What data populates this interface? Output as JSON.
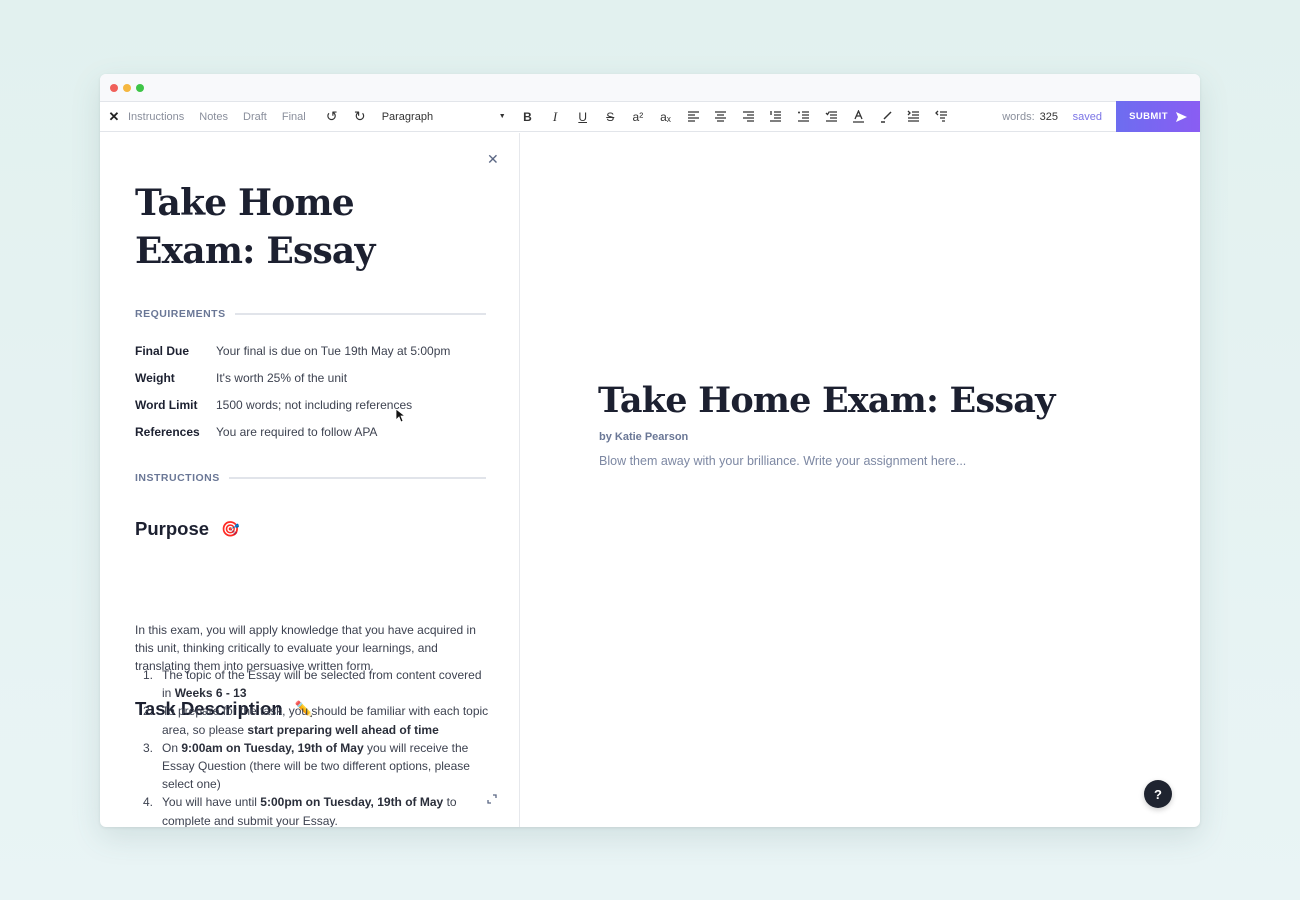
{
  "window": {
    "traffic_lights": {
      "close": "#f0605a",
      "minimize": "#f5b740",
      "maximize": "#3ec547"
    }
  },
  "toolbar": {
    "close_icon": "✕",
    "tabs": [
      {
        "label": "Instructions"
      },
      {
        "label": "Notes"
      },
      {
        "label": "Draft"
      },
      {
        "label": "Final"
      }
    ],
    "undo_icon": "↺",
    "redo_icon": "↻",
    "block_format": {
      "selected": "Paragraph",
      "caret": "▼"
    },
    "format_buttons": [
      {
        "name": "bold",
        "glyph": "B"
      },
      {
        "name": "italic",
        "glyph": "I"
      },
      {
        "name": "underline",
        "glyph": "U"
      },
      {
        "name": "strikethrough",
        "glyph": "S"
      },
      {
        "name": "superscript",
        "glyph": "a²"
      },
      {
        "name": "subscript",
        "glyph": "aₓ"
      },
      {
        "name": "align-left",
        "glyph": ""
      },
      {
        "name": "align-center",
        "glyph": ""
      },
      {
        "name": "align-right",
        "glyph": ""
      },
      {
        "name": "ordered-list",
        "glyph": ""
      },
      {
        "name": "bullet-list",
        "glyph": ""
      },
      {
        "name": "check-list",
        "glyph": ""
      },
      {
        "name": "text-color",
        "glyph": ""
      },
      {
        "name": "highlight",
        "glyph": ""
      },
      {
        "name": "indent",
        "glyph": ""
      },
      {
        "name": "outdent",
        "glyph": ""
      }
    ],
    "words_label": "words:",
    "word_count": "325",
    "save_status": "saved",
    "submit_label": "SUBMIT",
    "accent_color": "#7b74e6"
  },
  "instructions_panel": {
    "close_icon": "✕",
    "title": "Take Home Exam: Essay",
    "requirements_heading": "REQUIREMENTS",
    "requirements": [
      {
        "key": "Final Due",
        "value": "Your final is due on Tue 19th May at 5:00pm"
      },
      {
        "key": "Weight",
        "value": "It's worth 25% of the unit"
      },
      {
        "key": "Word Limit",
        "value": "1500 words; not including references"
      },
      {
        "key": "References",
        "value": "You are required to follow APA"
      }
    ],
    "instructions_heading": "INSTRUCTIONS",
    "purpose": {
      "heading": "Purpose",
      "emoji": "🎯",
      "text": "In this exam, you will apply knowledge that you have acquired in this unit, thinking critically to evaluate your learnings, and translating them into persuasive written form."
    },
    "task": {
      "heading": "Task Description",
      "emoji": "✏️",
      "items": [
        {
          "n": "1.",
          "pre": "The topic of the Essay will be selected from content covered in ",
          "bold": "Weeks 6 - 13",
          "post": ""
        },
        {
          "n": "2.",
          "pre": "To prepare for the task, you should be familiar with each topic area, so please ",
          "bold": "start preparing well ahead of time",
          "post": ""
        },
        {
          "n": "3.",
          "pre": "On ",
          "bold": "9:00am on Tuesday, 19th of May",
          "post": " you will receive the Essay Question (there will be two different options, please select one)"
        },
        {
          "n": "4.",
          "pre": "You will have until ",
          "bold": "5:00pm on Tuesday, 19th of May",
          "post": " to complete and submit your Essay."
        }
      ]
    }
  },
  "editor": {
    "title": "Take Home Exam: Essay",
    "byline": "by Katie Pearson",
    "placeholder": "Blow them away with your brilliance. Write your assignment here..."
  },
  "help_button": {
    "label": "?"
  }
}
